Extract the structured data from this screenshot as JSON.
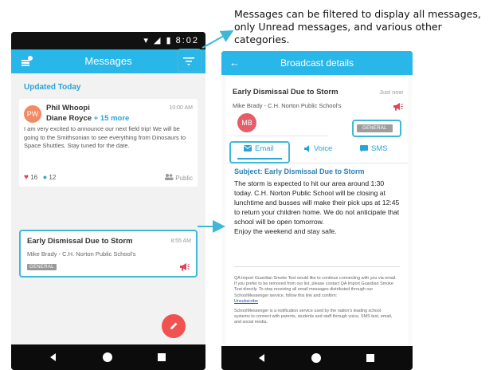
{
  "annotation": {
    "line1": "Messages can be filtered to display all messages,",
    "line2": "only Unread messages, and various other categories."
  },
  "left_phone": {
    "status_time": "8:02",
    "appbar_title": "Messages",
    "section_label": "Updated Today",
    "message1": {
      "avatar_initials": "PW",
      "name1": "Phil Whoopi",
      "name2": "Diane Royce",
      "more": "+ 15 more",
      "time": "10:00 AM",
      "body": "I am very excited to announce our next field trip! We will be going to the Smithsonian to see everything from Dinosaurs to Space Shuttles. Stay tuned for the date.",
      "likes": "16",
      "comments": "12",
      "visibility": "Public"
    },
    "message2": {
      "title": "Early Dismissal Due to Storm",
      "time": "8:55 AM",
      "sender": "Mike Brady - C.H. Norton Public School's",
      "badge": "GENERAL"
    }
  },
  "right_phone": {
    "appbar_title": "Broadcast details",
    "title": "Early Dismissal Due to Storm",
    "time": "Just now",
    "sender": "Mike Brady - C.H. Norton Public School's",
    "avatar_initials": "MB",
    "badge": "GENERAL",
    "tabs": {
      "email": "Email",
      "voice": "Voice",
      "sms": "SMS"
    },
    "subject": "Subject: Early Dismissal Due to Storm",
    "body_line1": "The storm is expected to hit our area around 1:30 today. C.H. Norton Public School will be closing at lunchtime and busses will make their pick ups at 12:45 to return your children home. We do not anticipate that school will be open tomorrow.",
    "body_line2": "Enjoy the weekend and stay safe.",
    "footer1": "QA Import Guardian Smoke Test would like to continue connecting with you via email. If you prefer to be removed from our list, please contact QA Import Guardian Smoke Test directly. To stop receiving all email messages distributed through our SchoolMessenger service, follow this link and confirm:",
    "unsubscribe": "Unsubscribe",
    "footer2": "SchoolMessenger is a notification service used by the nation's leading school systems to connect with parents, students and staff through voice, SMS text, email, and social media."
  },
  "colors": {
    "appbar": "#29b6e8",
    "highlight": "#3fb8d8",
    "accent_red": "#f0524f",
    "link_blue": "#2aa3d6"
  }
}
